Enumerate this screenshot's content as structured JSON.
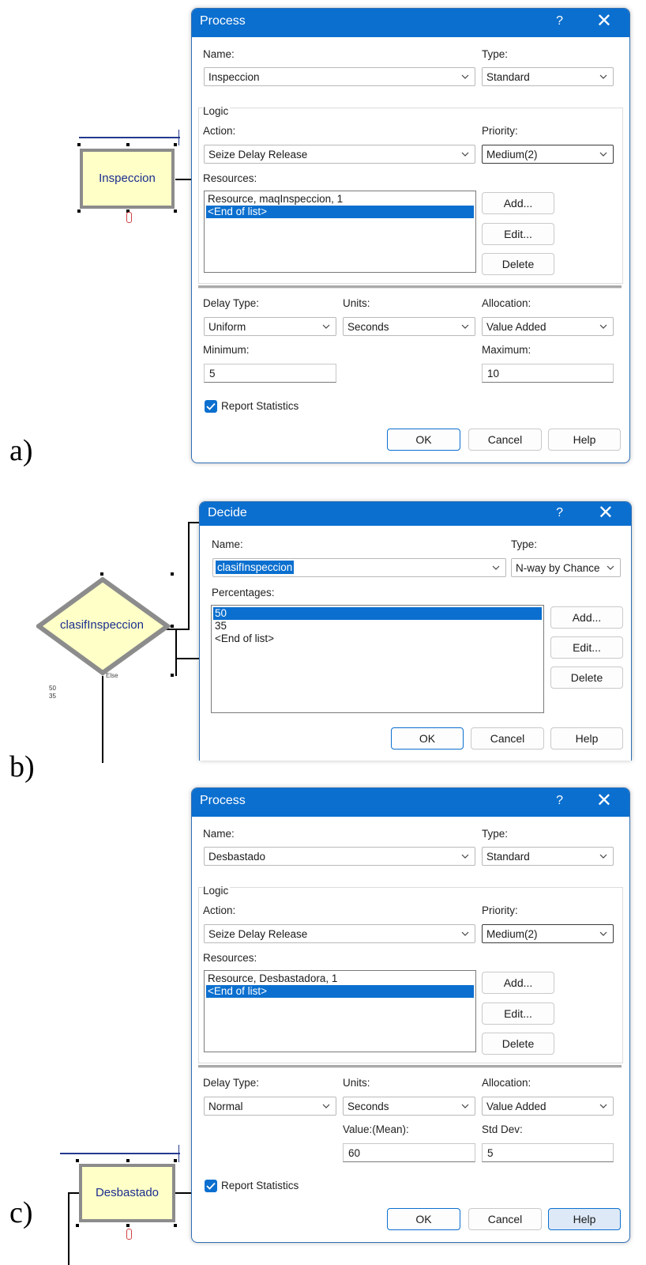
{
  "panel_labels": {
    "a": "a)",
    "b": "b)",
    "c": "c)"
  },
  "colors": {
    "title_bar": "#0b6fcf",
    "selection": "#0b6fcf",
    "module_fill": "#ffffc8",
    "module_text": "#1a2d8f"
  },
  "icons": {
    "help": "question-mark-icon",
    "close": "close-x-icon",
    "dropdown": "chevron-down-icon",
    "checkbox": "checkmark-icon"
  },
  "a": {
    "module_label": "Inspeccion",
    "dialog": {
      "title": "Process",
      "help_glyph": "?",
      "close_glyph": "✕",
      "name_label": "Name:",
      "name_value": "Inspeccion",
      "type_label": "Type:",
      "type_value": "Standard",
      "logic_label": "Logic",
      "action_label": "Action:",
      "action_value": "Seize Delay Release",
      "priority_label": "Priority:",
      "priority_value": "Medium(2)",
      "resources_label": "Resources:",
      "resources": [
        "Resource, maqInspeccion, 1",
        "<End of list>"
      ],
      "add": "Add...",
      "edit": "Edit...",
      "delete": "Delete",
      "delay_type_label": "Delay Type:",
      "delay_type_value": "Uniform",
      "units_label": "Units:",
      "units_value": "Seconds",
      "allocation_label": "Allocation:",
      "allocation_value": "Value Added",
      "param1_label": "Minimum:",
      "param1_value": "5",
      "param2_label": "Maximum:",
      "param2_value": "10",
      "report_statistics": "Report Statistics",
      "ok": "OK",
      "cancel": "Cancel",
      "help": "Help"
    }
  },
  "b": {
    "module_label": "clasifInspeccion",
    "else_label": "Else",
    "side_values": [
      "50",
      "35"
    ],
    "dialog": {
      "title": "Decide",
      "help_glyph": "?",
      "close_glyph": "✕",
      "name_label": "Name:",
      "name_value": "clasifInspeccion",
      "type_label": "Type:",
      "type_value": "N-way by Chance",
      "percentages_label": "Percentages:",
      "percentages": [
        "50",
        "35",
        "<End of list>"
      ],
      "add": "Add...",
      "edit": "Edit...",
      "delete": "Delete",
      "ok": "OK",
      "cancel": "Cancel",
      "help": "Help"
    }
  },
  "c": {
    "module_label": "Desbastado",
    "dialog": {
      "title": "Process",
      "help_glyph": "?",
      "close_glyph": "✕",
      "name_label": "Name:",
      "name_value": "Desbastado",
      "type_label": "Type:",
      "type_value": "Standard",
      "logic_label": "Logic",
      "action_label": "Action:",
      "action_value": "Seize Delay Release",
      "priority_label": "Priority:",
      "priority_value": "Medium(2)",
      "resources_label": "Resources:",
      "resources": [
        "Resource, Desbastadora, 1",
        "<End of list>"
      ],
      "add": "Add...",
      "edit": "Edit...",
      "delete": "Delete",
      "delay_type_label": "Delay Type:",
      "delay_type_value": "Normal",
      "units_label": "Units:",
      "units_value": "Seconds",
      "allocation_label": "Allocation:",
      "allocation_value": "Value Added",
      "param1_label": "Value:(Mean):",
      "param1_value": "60",
      "param2_label": "Std Dev:",
      "param2_value": "5",
      "report_statistics": "Report Statistics",
      "ok": "OK",
      "cancel": "Cancel",
      "help": "Help"
    }
  }
}
